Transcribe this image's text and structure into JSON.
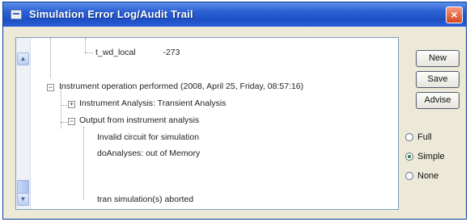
{
  "window": {
    "title": "Simulation Error Log/Audit Trail",
    "close_glyph": "×"
  },
  "log": {
    "partial_line": {
      "name": "t_wd_local",
      "value": "-273"
    },
    "operation_header": "Instrument operation performed   (2008, April 25, Friday, 08:57:16)",
    "analysis_node": "Instrument Analysis: Transient Analysis",
    "output_node": "Output from instrument analysis",
    "messages": [
      "Invalid circuit for simulation",
      "doAnalyses: out of Memory"
    ],
    "final_message": "tran simulation(s) aborted"
  },
  "buttons": {
    "new": "New",
    "save": "Save",
    "advise": "Advise"
  },
  "mode": {
    "options": [
      "Full",
      "Simple",
      "None"
    ],
    "selected": "Simple"
  },
  "scrollbar": {
    "up_glyph": "▲",
    "down_glyph": "▼"
  }
}
